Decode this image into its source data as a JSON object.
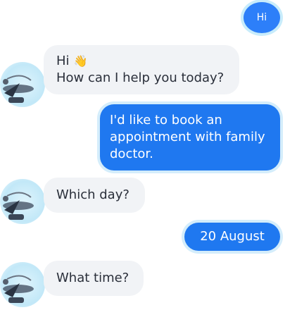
{
  "user": {
    "avatar_label": "Hi"
  },
  "messages": {
    "greeting": {
      "line1": "Hi",
      "wave_icon": "👋",
      "line2": "How can I help you today?"
    },
    "request": {
      "text": "I'd like to book an appointment with family doctor."
    },
    "which_day": {
      "text": "Which day?"
    },
    "date_reply": {
      "text": "20 August"
    },
    "what_time": {
      "text": "What time?"
    }
  },
  "colors": {
    "user_bubble": "#1f78f0",
    "bot_bubble": "#f1f3f6",
    "bubble_halo": "#d4edfb"
  }
}
